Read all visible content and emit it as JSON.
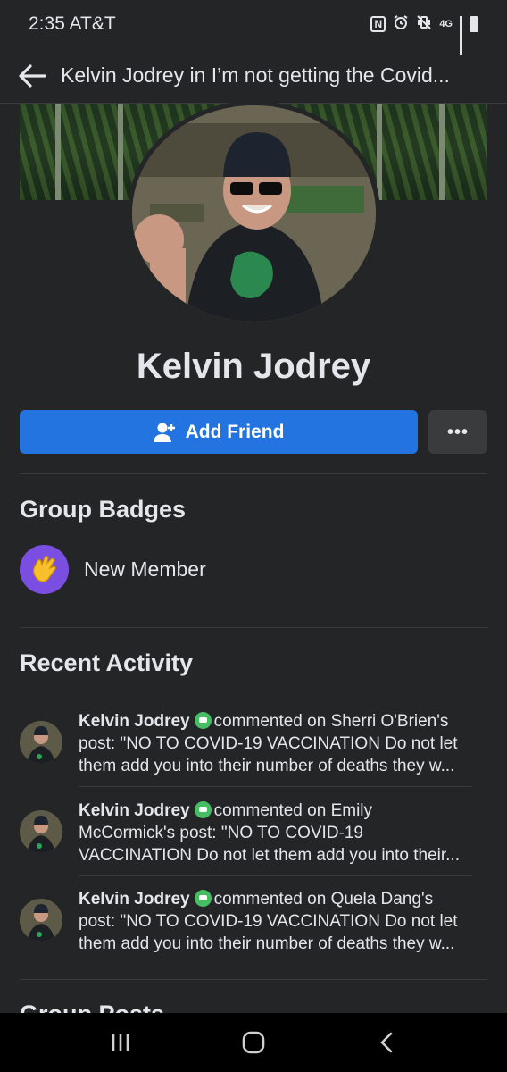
{
  "status_bar": {
    "time": "2:35 AT&T",
    "nfc_label": "N",
    "network_label": "4G"
  },
  "header": {
    "title": "Kelvin Jodrey in I’m not getting the Covid..."
  },
  "profile": {
    "name": "Kelvin Jodrey",
    "add_friend_label": "Add Friend",
    "more_label": "•••"
  },
  "badges": {
    "title": "Group Badges",
    "items": [
      {
        "label": "New Member",
        "icon": "waving-hand-icon"
      }
    ]
  },
  "activity": {
    "title": "Recent Activity",
    "items": [
      {
        "name": "Kelvin Jodrey",
        "line1_rest": "commented on Sherri O'Brien's",
        "line2": "post: \"NO TO COVID-19 VACCINATION Do not let",
        "line3": "them add you into their number of deaths they w..."
      },
      {
        "name": "Kelvin Jodrey",
        "line1_rest": "commented on Emily",
        "line2": "McCormick's post: \"NO TO COVID-19",
        "line3": "VACCINATION Do not let them add you into their..."
      },
      {
        "name": "Kelvin Jodrey",
        "line1_rest": "commented on Quela Dang's",
        "line2": "post: \"NO TO COVID-19 VACCINATION Do not let",
        "line3": "them add you into their number of deaths they w..."
      }
    ]
  },
  "next_section": {
    "title": "Group Posts"
  },
  "colors": {
    "background": "#242526",
    "primary_button": "#2374e1",
    "badge": "#7b4ee2",
    "comment_badge": "#45bd62"
  },
  "nav": {
    "recents": "recents-icon",
    "home": "home-icon",
    "back": "back-icon"
  }
}
